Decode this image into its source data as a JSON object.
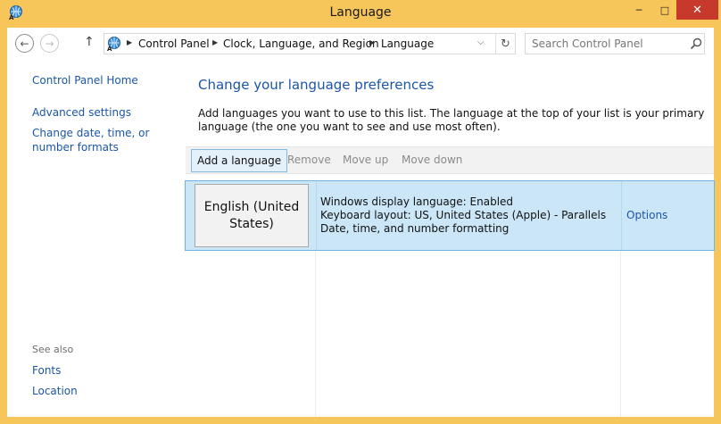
{
  "window": {
    "title": "Language",
    "minimize_glyph": "─",
    "maximize_glyph": "□",
    "close_glyph": "✕",
    "icon": "language-icon"
  },
  "nav": {
    "back_glyph": "←",
    "forward_glyph": "→",
    "up_glyph": "↑",
    "breadcrumb": [
      "Control Panel",
      "Clock, Language, and Region",
      "Language"
    ],
    "separator_glyph": "▶",
    "dropdown_glyph": "⌵",
    "refresh_glyph": "↻"
  },
  "search": {
    "placeholder": "Search Control Panel"
  },
  "sidebar": {
    "home": "Control Panel Home",
    "links": [
      "Advanced settings",
      "Change date, time, or number formats"
    ],
    "see_also_label": "See also",
    "see_also": [
      "Fonts",
      "Location"
    ]
  },
  "main": {
    "heading": "Change your language preferences",
    "description": "Add languages you want to use to this list. The language at the top of your list is your primary language (the one you want to see and use most often)."
  },
  "toolbar": {
    "add": "Add a language",
    "remove": "Remove",
    "move_up": "Move up",
    "move_down": "Move down"
  },
  "languages": [
    {
      "name": "English (United States)",
      "details": [
        "Windows display language: Enabled",
        "Keyboard layout: US, United States (Apple) - Parallels",
        "Date, time, and number formatting"
      ],
      "options": "Options"
    }
  ],
  "colors": {
    "title_bar": "#f6c65a",
    "link": "#1b56a6",
    "selected_row": "#cbe6f7",
    "close_button": "#c7392a"
  }
}
